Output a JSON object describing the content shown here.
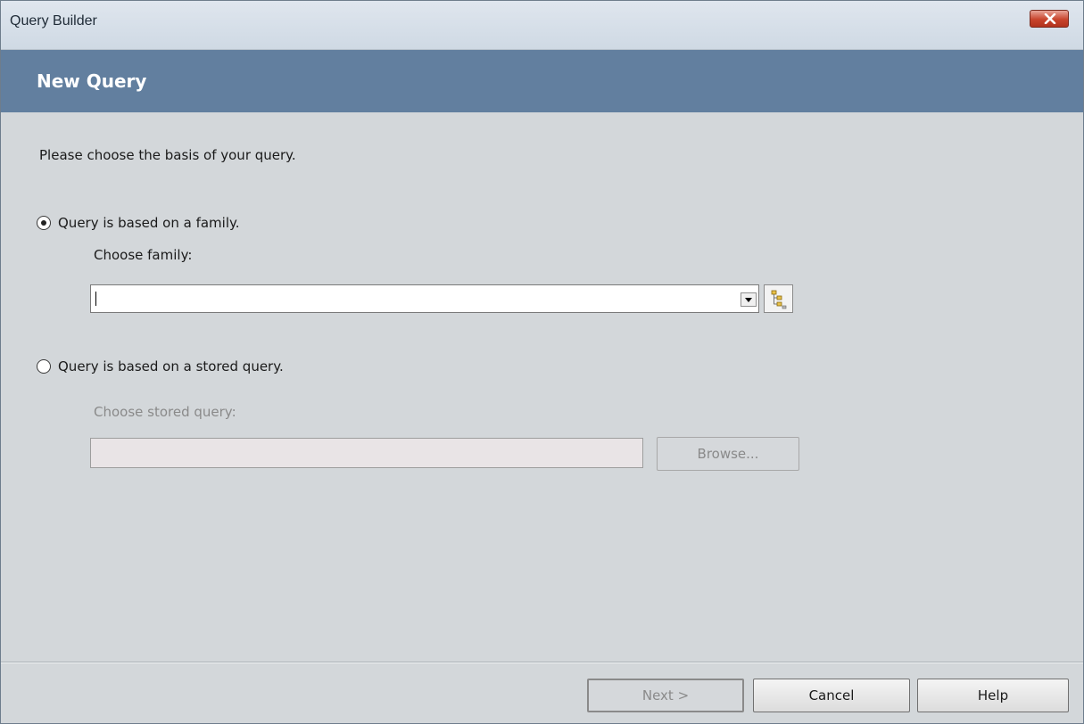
{
  "window": {
    "title": "Query Builder",
    "close_icon": "close-icon"
  },
  "header": {
    "title": "New Query"
  },
  "content": {
    "instruction": "Please choose the basis of your query.",
    "family_option": {
      "label": "Query is based on a family.",
      "selected": true,
      "choose_label": "Choose family:",
      "value": "",
      "tree_icon": "family-tree-icon"
    },
    "stored_option": {
      "label": "Query is based on a stored query.",
      "selected": false,
      "choose_label": "Choose stored query:",
      "value": "",
      "browse_label": "Browse..."
    }
  },
  "footer": {
    "next_label": "Next >",
    "cancel_label": "Cancel",
    "help_label": "Help"
  },
  "colors": {
    "header_band": "#627f9f",
    "body_background": "#d3d7da",
    "close_button": "#c8442c"
  }
}
